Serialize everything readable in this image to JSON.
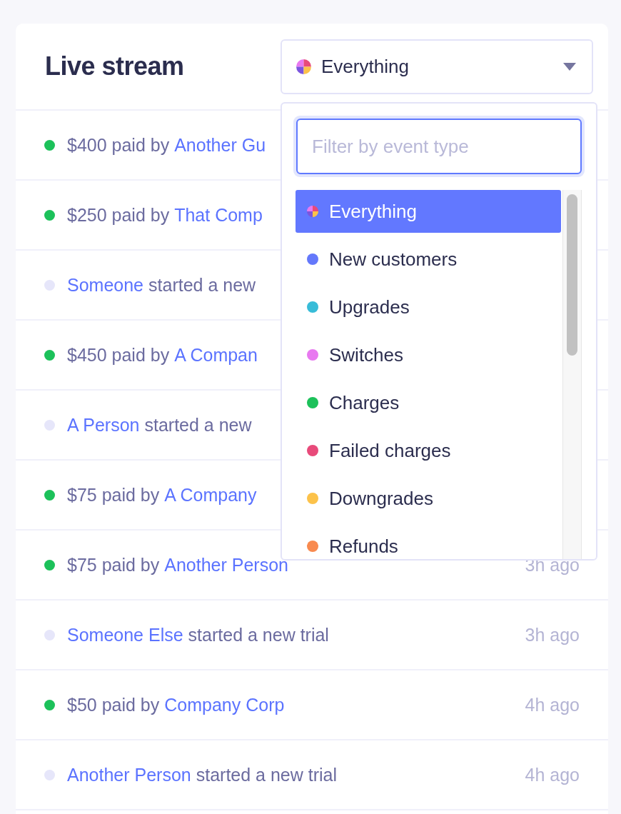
{
  "card": {
    "title": "Live stream"
  },
  "filter": {
    "selected_label": "Everything",
    "search": {
      "placeholder": "Filter by event type"
    },
    "options": [
      {
        "label": "Everything",
        "kind": "all",
        "selected": true
      },
      {
        "label": "New customers",
        "kind": "dot",
        "color": "#6478fb",
        "selected": false
      },
      {
        "label": "Upgrades",
        "kind": "dot",
        "color": "#38bcd8",
        "selected": false
      },
      {
        "label": "Switches",
        "kind": "dot",
        "color": "#e879f0",
        "selected": false
      },
      {
        "label": "Charges",
        "kind": "dot",
        "color": "#1cc15a",
        "selected": false
      },
      {
        "label": "Failed charges",
        "kind": "dot",
        "color": "#e84a7a",
        "selected": false
      },
      {
        "label": "Downgrades",
        "kind": "dot",
        "color": "#fcc24a",
        "selected": false
      },
      {
        "label": "Refunds",
        "kind": "dot",
        "color": "#f88a4f",
        "selected": false
      }
    ]
  },
  "events": [
    {
      "color": "#1cc15a",
      "before": "$400 paid by",
      "link": "Another Gu"
    },
    {
      "color": "#1cc15a",
      "before": "$250 paid by",
      "link": "That Comp"
    },
    {
      "color": "#e6e6fa",
      "link": "Someone",
      "after": "started a new"
    },
    {
      "color": "#1cc15a",
      "before": "$450 paid by",
      "link": "A Compan"
    },
    {
      "color": "#e6e6fa",
      "link": "A Person",
      "after": "started a new"
    },
    {
      "color": "#1cc15a",
      "before": "$75 paid by",
      "link": "A Company"
    },
    {
      "color": "#1cc15a",
      "before": "$75 paid by",
      "link": "Another Person",
      "time": "3h ago"
    },
    {
      "color": "#e6e6fa",
      "link": "Someone Else",
      "after": "started a new trial",
      "time": "3h ago"
    },
    {
      "color": "#1cc15a",
      "before": "$50 paid by",
      "link": "Company Corp",
      "time": "4h ago"
    },
    {
      "color": "#e6e6fa",
      "link": "Another Person",
      "after": "started a new trial",
      "time": "4h ago"
    }
  ]
}
